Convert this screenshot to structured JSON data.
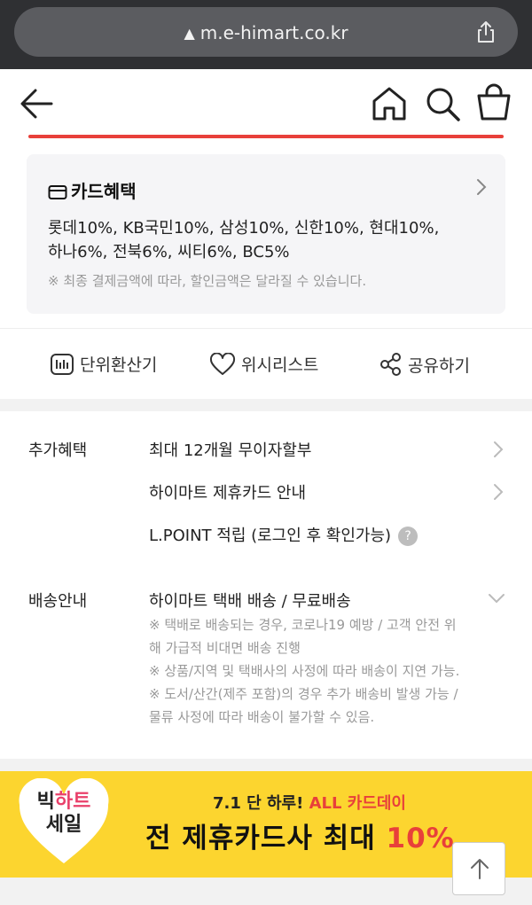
{
  "browser": {
    "url": "m.e-himart.co.kr"
  },
  "card_benefit": {
    "title": "카드혜택",
    "lines": [
      "롯데10%, KB국민10%, 삼성10%, 신한10%, 현대10%,",
      "하나6%, 전북6%, 씨티6%, BC5%"
    ],
    "note": "※ 최종 결제금액에 따라, 할인금액은 달라질 수 있습니다."
  },
  "actions": {
    "unit_converter": "단위환산기",
    "wishlist": "위시리스트",
    "share": "공유하기"
  },
  "extra_benefits": {
    "label": "추가혜택",
    "items": [
      "최대 12개월 무이자할부",
      "하이마트 제휴카드 안내",
      "L.POINT 적립 (로그인 후 확인가능)"
    ],
    "help": "?"
  },
  "shipping": {
    "label": "배송안내",
    "main": "하이마트 택배 배송 / 무료배송",
    "notes": [
      "※ 택배로 배송되는 경우, 코로나19 예방 / 고객 안전 위",
      "해 가급적 비대면 배송 진행",
      "※ 상품/지역 및 택배사의 사정에 따라 배송이 지연 가능.",
      "※ 도서/산간(제주 포함)의 경우 추가 배송비 발생 가능 /",
      "물류 사정에 따라 배송이 불가할 수 있음."
    ]
  },
  "banner": {
    "badge_line1_a": "빅",
    "badge_line1_b": "하트",
    "badge_line2": "세일",
    "sub_a": "7.1 단 하루! ",
    "sub_b": "ALL 카드데이",
    "main_a": "전 제휴카드사 최대 ",
    "main_b": "10%"
  },
  "colors": {
    "accent_red": "#e8403a",
    "banner_yellow": "#fcd52f",
    "badge_pink": "#e9406a"
  }
}
